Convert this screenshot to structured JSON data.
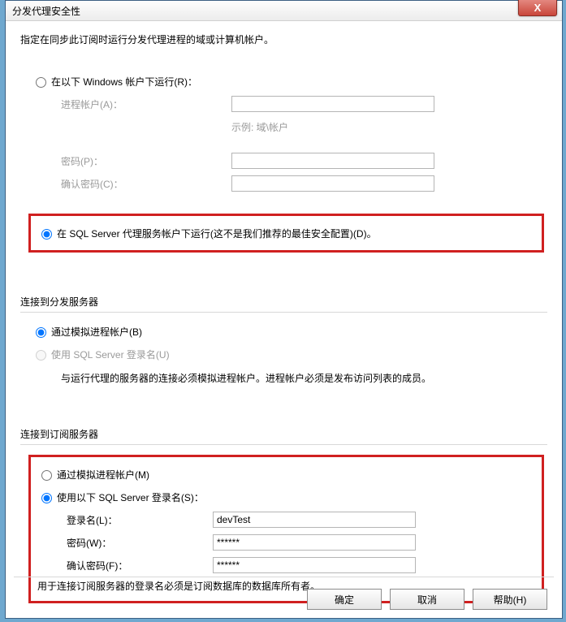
{
  "window": {
    "title": "分发代理安全性",
    "close": "X"
  },
  "intro": "指定在同步此订阅时运行分发代理进程的域或计算机帐户。",
  "runAs": {
    "windowsAccount": {
      "label": "在以下 Windows 帐户下运行(R)：",
      "processAccount": "进程帐户(A)：",
      "processValue": "",
      "example": "示例: 域\\帐户",
      "password": "密码(P)：",
      "passwordValue": "",
      "confirm": "确认密码(C)：",
      "confirmValue": ""
    },
    "sqlAgent": {
      "label": "在 SQL Server 代理服务帐户下运行(这不是我们推荐的最佳安全配置)(D)。"
    }
  },
  "connectDist": {
    "title": "连接到分发服务器",
    "impersonate": "通过模拟进程帐户(B)",
    "sqlLogin": "使用 SQL Server 登录名(U)",
    "note": "与运行代理的服务器的连接必须模拟进程帐户。进程帐户必须是发布访问列表的成员。"
  },
  "connectSub": {
    "title": "连接到订阅服务器",
    "impersonate": "通过模拟进程帐户(M)",
    "sqlLogin": "使用以下 SQL Server 登录名(S)：",
    "login": "登录名(L)：",
    "loginValue": "devTest",
    "password": "密码(W)：",
    "passwordValue": "******",
    "confirm": "确认密码(F)：",
    "confirmValue": "******",
    "note": "用于连接订阅服务器的登录名必须是订阅数据库的数据库所有者。"
  },
  "buttons": {
    "ok": "确定",
    "cancel": "取消",
    "help": "帮助(H)"
  }
}
